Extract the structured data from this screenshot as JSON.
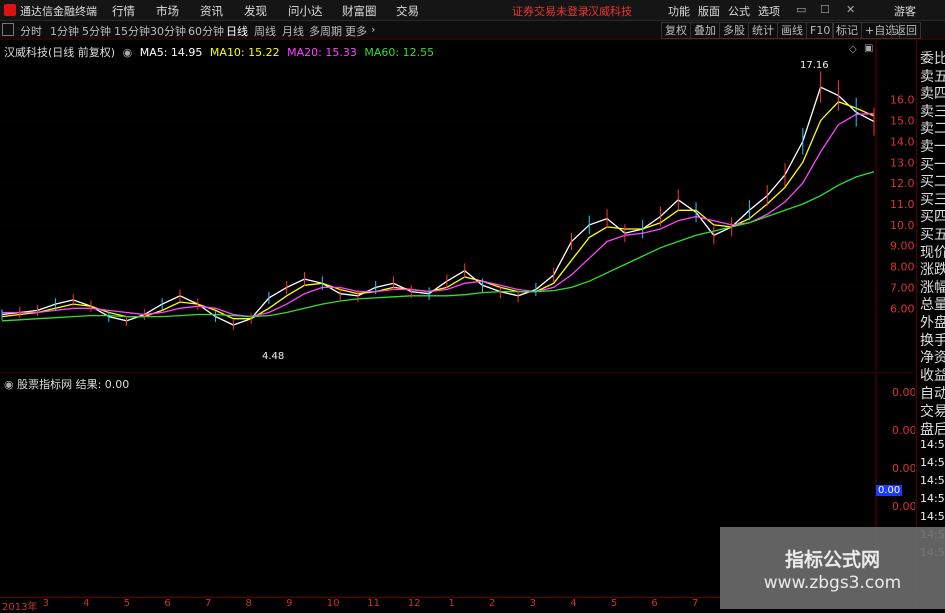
{
  "topbar": {
    "app_name": "通达信金融终端",
    "menus": [
      "行情",
      "市场",
      "资讯",
      "发现",
      "问小达",
      "财富圈",
      "交易"
    ],
    "warning": "证券交易未登录",
    "stock_name": "汉威科技",
    "right_items": [
      "功能",
      "版面",
      "公式",
      "选项"
    ],
    "guest": "游客"
  },
  "periodbar": {
    "periods": [
      "分时",
      "1分钟",
      "5分钟",
      "15分钟",
      "30分钟",
      "60分钟",
      "日线",
      "周线",
      "月线",
      "多周期",
      "更多"
    ],
    "active": "日线",
    "tools": [
      "复权",
      "叠加",
      "多股",
      "统计",
      "画线",
      "F10",
      "标记",
      "+自选",
      "返回"
    ]
  },
  "main_chart": {
    "title": "汉威科技(日线 前复权)",
    "ma": [
      {
        "label": "MA5: 14.95",
        "color": "#ffffff"
      },
      {
        "label": "MA10: 15.22",
        "color": "#ffff00"
      },
      {
        "label": "MA20: 15.33",
        "color": "#ff44ff"
      },
      {
        "label": "MA60: 12.55",
        "color": "#33dd33"
      }
    ],
    "high_label": "17.16",
    "low_label": "4.48"
  },
  "indicator": {
    "name": "股票指标网",
    "result_label": "结果: 0.00",
    "current_value": "0.00"
  },
  "side_panel": {
    "items": [
      "委比",
      "卖五",
      "卖四",
      "卖三",
      "卖二",
      "卖一",
      "买一",
      "买二",
      "买三",
      "买四",
      "买五",
      "现价",
      "涨跌",
      "涨幅",
      "总量",
      "外盘",
      "换手",
      "净资",
      "收益"
    ],
    "lower_items": [
      "自动",
      "交易",
      "盘后"
    ],
    "times": [
      "14:50",
      "14:50",
      "14:50",
      "14:50",
      "14:50",
      "14:50",
      "14:50"
    ]
  },
  "chart_data": {
    "type": "line",
    "title": "汉威科技(日线 前复权)",
    "y_ticks": [
      "16.00",
      "15.00",
      "14.00",
      "13.00",
      "12.00",
      "11.00",
      "10.00",
      "9.00",
      "8.00",
      "7.00",
      "6.00"
    ],
    "ylim": [
      4.0,
      18.0
    ],
    "x_ticks": [
      "2013年",
      "3",
      "4",
      "5",
      "6",
      "7",
      "8",
      "9",
      "10",
      "11",
      "12",
      "1",
      "2",
      "3",
      "4",
      "5",
      "6",
      "7"
    ],
    "series": [
      {
        "name": "MA5",
        "color": "#ffffff",
        "values": [
          5.7,
          5.8,
          5.9,
          6.2,
          6.4,
          6.1,
          5.6,
          5.4,
          5.7,
          6.2,
          6.6,
          6.2,
          5.6,
          5.2,
          5.5,
          6.5,
          7.0,
          7.4,
          7.2,
          6.7,
          6.6,
          7.0,
          7.2,
          6.8,
          6.7,
          7.3,
          7.8,
          7.1,
          6.8,
          6.6,
          6.9,
          7.6,
          9.2,
          10.0,
          10.3,
          9.6,
          9.8,
          10.4,
          11.2,
          10.6,
          9.5,
          9.9,
          10.7,
          11.4,
          12.4,
          14.0,
          16.6,
          16.2,
          15.4,
          14.95
        ]
      },
      {
        "name": "MA10",
        "color": "#ffff00",
        "values": [
          5.6,
          5.7,
          5.8,
          6.0,
          6.2,
          6.1,
          5.8,
          5.6,
          5.6,
          5.9,
          6.3,
          6.2,
          5.9,
          5.5,
          5.5,
          6.0,
          6.6,
          7.1,
          7.2,
          6.9,
          6.7,
          6.8,
          7.0,
          6.9,
          6.8,
          7.0,
          7.5,
          7.3,
          7.0,
          6.8,
          6.8,
          7.2,
          8.3,
          9.4,
          9.9,
          9.8,
          9.8,
          10.1,
          10.7,
          10.7,
          10.0,
          9.9,
          10.3,
          11.0,
          11.8,
          13.0,
          15.0,
          15.9,
          15.6,
          15.22
        ]
      },
      {
        "name": "MA20",
        "color": "#ff44ff",
        "values": [
          5.8,
          5.8,
          5.8,
          5.9,
          6.0,
          6.0,
          5.9,
          5.8,
          5.7,
          5.8,
          6.0,
          6.1,
          6.0,
          5.7,
          5.6,
          5.8,
          6.2,
          6.7,
          7.0,
          7.0,
          6.8,
          6.8,
          6.9,
          6.9,
          6.8,
          6.9,
          7.2,
          7.3,
          7.1,
          6.9,
          6.8,
          7.0,
          7.6,
          8.4,
          9.2,
          9.5,
          9.6,
          9.8,
          10.2,
          10.4,
          10.2,
          10.0,
          10.1,
          10.5,
          11.1,
          12.0,
          13.5,
          14.8,
          15.3,
          15.33
        ]
      },
      {
        "name": "MA60",
        "color": "#33dd33",
        "values": [
          5.4,
          5.45,
          5.5,
          5.55,
          5.6,
          5.65,
          5.65,
          5.6,
          5.6,
          5.6,
          5.65,
          5.7,
          5.7,
          5.65,
          5.6,
          5.65,
          5.8,
          6.0,
          6.2,
          6.35,
          6.45,
          6.5,
          6.55,
          6.6,
          6.6,
          6.6,
          6.65,
          6.75,
          6.8,
          6.8,
          6.8,
          6.85,
          7.0,
          7.3,
          7.7,
          8.1,
          8.5,
          8.9,
          9.2,
          9.5,
          9.7,
          9.9,
          10.1,
          10.4,
          10.7,
          11.0,
          11.4,
          11.9,
          12.3,
          12.55
        ]
      }
    ],
    "indicator_ticks": [
      "0.00",
      "0.00",
      "0.00",
      "0.00"
    ]
  }
}
